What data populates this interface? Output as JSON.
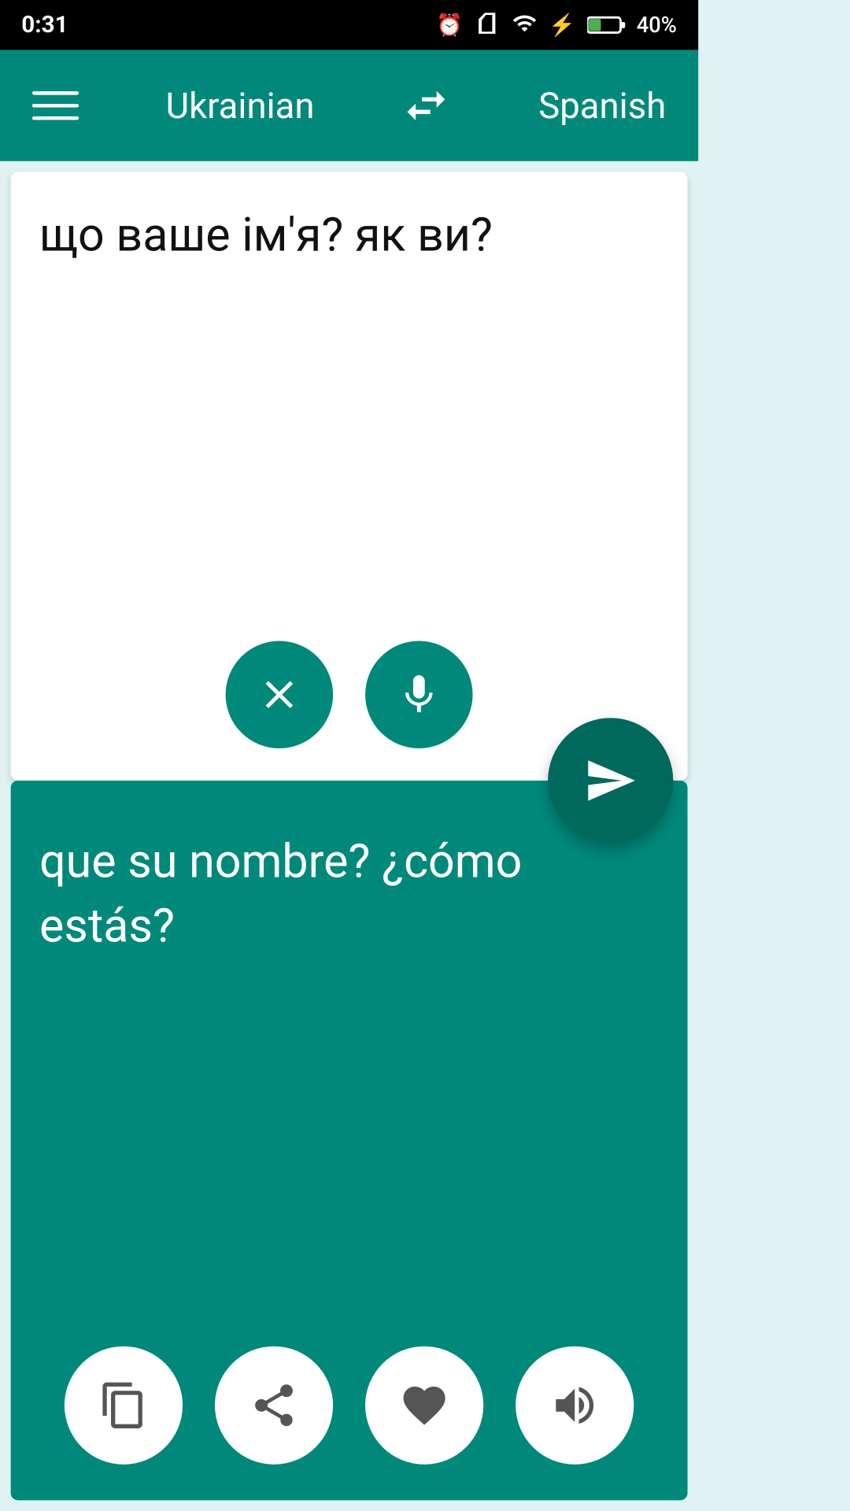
{
  "status": {
    "time": "0:31",
    "battery": "40%"
  },
  "toolbar": {
    "menu_label": "menu",
    "source_lang": "Ukrainian",
    "target_lang": "Spanish"
  },
  "source": {
    "text": "що ваше ім'я? як ви?"
  },
  "translation": {
    "text": "que su nombre? ¿cómo estás?"
  },
  "buttons": {
    "clear_label": "clear",
    "mic_label": "microphone",
    "send_label": "send",
    "copy_label": "copy",
    "share_label": "share",
    "favorite_label": "favorite",
    "speaker_label": "speaker"
  }
}
